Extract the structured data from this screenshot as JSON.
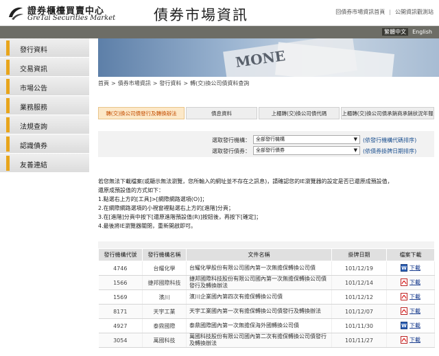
{
  "header": {
    "logo_zh": "證券櫃檯買賣中心",
    "logo_en": "GreTai Securities Market",
    "site_title": "債券市場資訊",
    "top_links": [
      "回債券市場資訊首頁",
      "公開資訊觀測站"
    ]
  },
  "lang": {
    "active": "繁體中文",
    "other": "English"
  },
  "banner": {
    "word": "MONE"
  },
  "sidebar": {
    "items": [
      {
        "label": "發行資料"
      },
      {
        "label": "交易資訊"
      },
      {
        "label": "市場公告"
      },
      {
        "label": "業務服務"
      },
      {
        "label": "法規查詢"
      },
      {
        "label": "認識債券"
      },
      {
        "label": "友善連結"
      }
    ]
  },
  "breadcrumb": [
    "首頁",
    "債券市場資訊",
    "發行資料",
    "轉(交)換公司債資料查詢"
  ],
  "tabs": [
    {
      "label": "轉(交)換公司債發行及轉換辦法",
      "active": true
    },
    {
      "label": "債息資料",
      "active": false
    },
    {
      "label": "上櫃轉(交)換公司債代碼",
      "active": false
    },
    {
      "label": "上櫃轉(交)換公司債承銷商承銷狀況年報",
      "active": false
    }
  ],
  "filters": {
    "row1": {
      "label": "選取發行機構：",
      "value": "全部發行機構",
      "note": "(依發行機構代碼排序)"
    },
    "row2": {
      "label": "選取發行債券：",
      "value": "全部發行債券",
      "note": "(依債券掛牌日期排序)"
    }
  },
  "instructions": [
    "若您無法下載檔案(或顯示無法瀏覽，您所輸入的網址並不存在之訊息)，請確認您的IE瀏覽器的設定是否已還原成預設值，",
    "還原成預設值的方式如下：",
    "1.點選右上方的[工具]>[網際網路選項(O)]；",
    "2.在網際網路選項的小視窗裡點選右上方的[進階]分頁；",
    "3.在[進階]分頁中按下[還原進階預設值(R)]按鈕後，再按下[確定]；",
    "4.最後將IE瀏覽器關閉，重新開啟即可。"
  ],
  "table": {
    "columns": [
      "發行機構代號",
      "發行機構名稱",
      "文件名稱",
      "掛牌日期",
      "檔案下載"
    ],
    "rows": [
      {
        "code": "4746",
        "name": "台耀化學",
        "file": "台耀化學股份有限公司國內第一次無擔保轉換公司債",
        "date": "101/12/19",
        "icon": "word",
        "dl": "下載"
      },
      {
        "code": "1566",
        "name": "捷邦國際科技",
        "file": "捷邦國際科技股份有限公司國內第一次無擔保轉換公司債發行及轉換辦法",
        "date": "101/12/14",
        "icon": "pdf",
        "dl": "下載"
      },
      {
        "code": "1569",
        "name": "濱川",
        "file": "濱川企業國內第四次有擔保轉換公司債",
        "date": "101/12/12",
        "icon": "pdf",
        "dl": "下載"
      },
      {
        "code": "8171",
        "name": "天宇工業",
        "file": "天宇工業國內第一次有擔保轉換公司債發行及轉換辦法",
        "date": "101/12/07",
        "icon": "pdf",
        "dl": "下載"
      },
      {
        "code": "4927",
        "name": "泰鼎國際",
        "file": "泰鼎國際國內第一次無擔保海外國轉換公司債",
        "date": "101/11/30",
        "icon": "word",
        "dl": "下載"
      },
      {
        "code": "3054",
        "name": "萬國科技",
        "file": "萬國科技股份有限公司國內第二次有擔保轉換公司債發行及轉換辦法",
        "date": "101/11/27",
        "icon": "pdf",
        "dl": "下載"
      }
    ]
  },
  "colors": {
    "accent": "#e8a51b",
    "darkbar": "#6d6d66",
    "active_tab_text": "#c44d00",
    "link": "#1a4f8f"
  }
}
